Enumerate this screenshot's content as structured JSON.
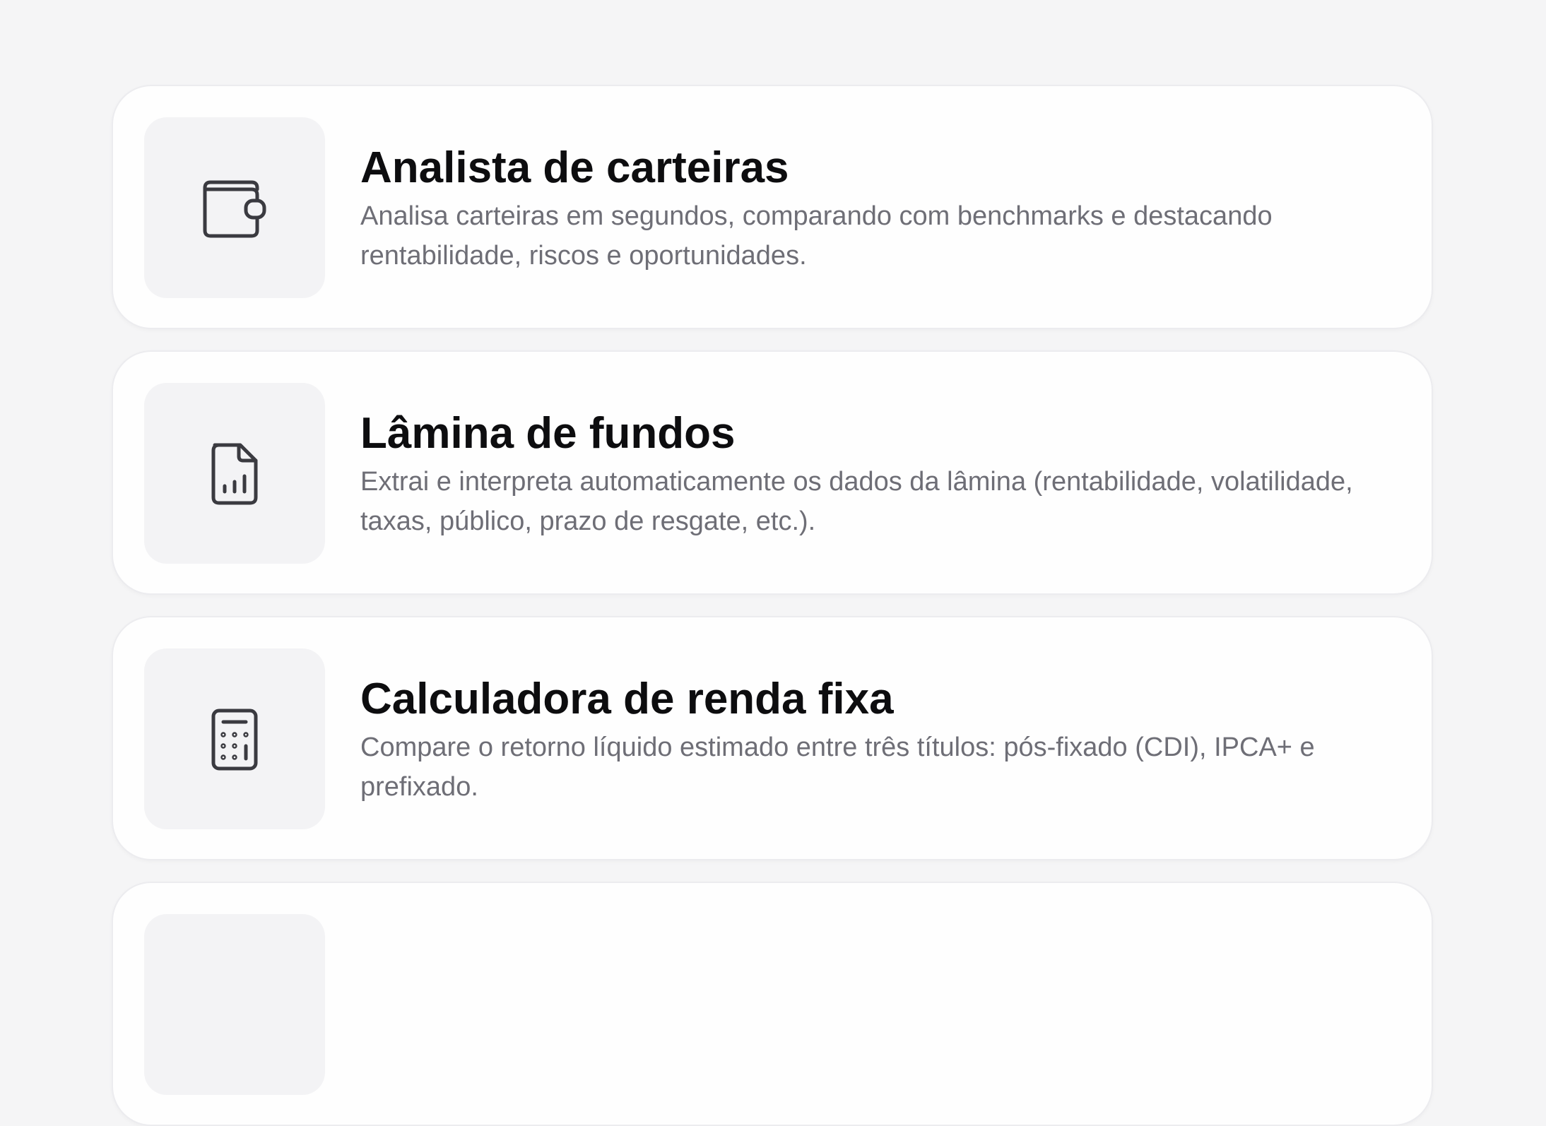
{
  "tools": [
    {
      "icon": "wallet-icon",
      "title": "Analista de carteiras",
      "description": "Analisa carteiras em segundos, comparando com benchmarks e destacando rentabilidade, riscos e oportunidades."
    },
    {
      "icon": "document-chart-icon",
      "title": "Lâmina de fundos",
      "description": "Extrai e interpreta automaticamente os dados da lâmina (rentabilidade, volatilidade, taxas, público, prazo de resgate, etc.)."
    },
    {
      "icon": "calculator-icon",
      "title": "Calculadora de renda fixa",
      "description": "Compare o retorno líquido estimado entre três títulos: pós-fixado (CDI), IPCA+ e prefixado."
    }
  ],
  "colors": {
    "background": "#f5f5f6",
    "card": "#fefefe",
    "icon_tile": "#f3f3f5",
    "title": "#0d0d0f",
    "description": "#6e6e76",
    "icon_stroke": "#3a3a40"
  }
}
